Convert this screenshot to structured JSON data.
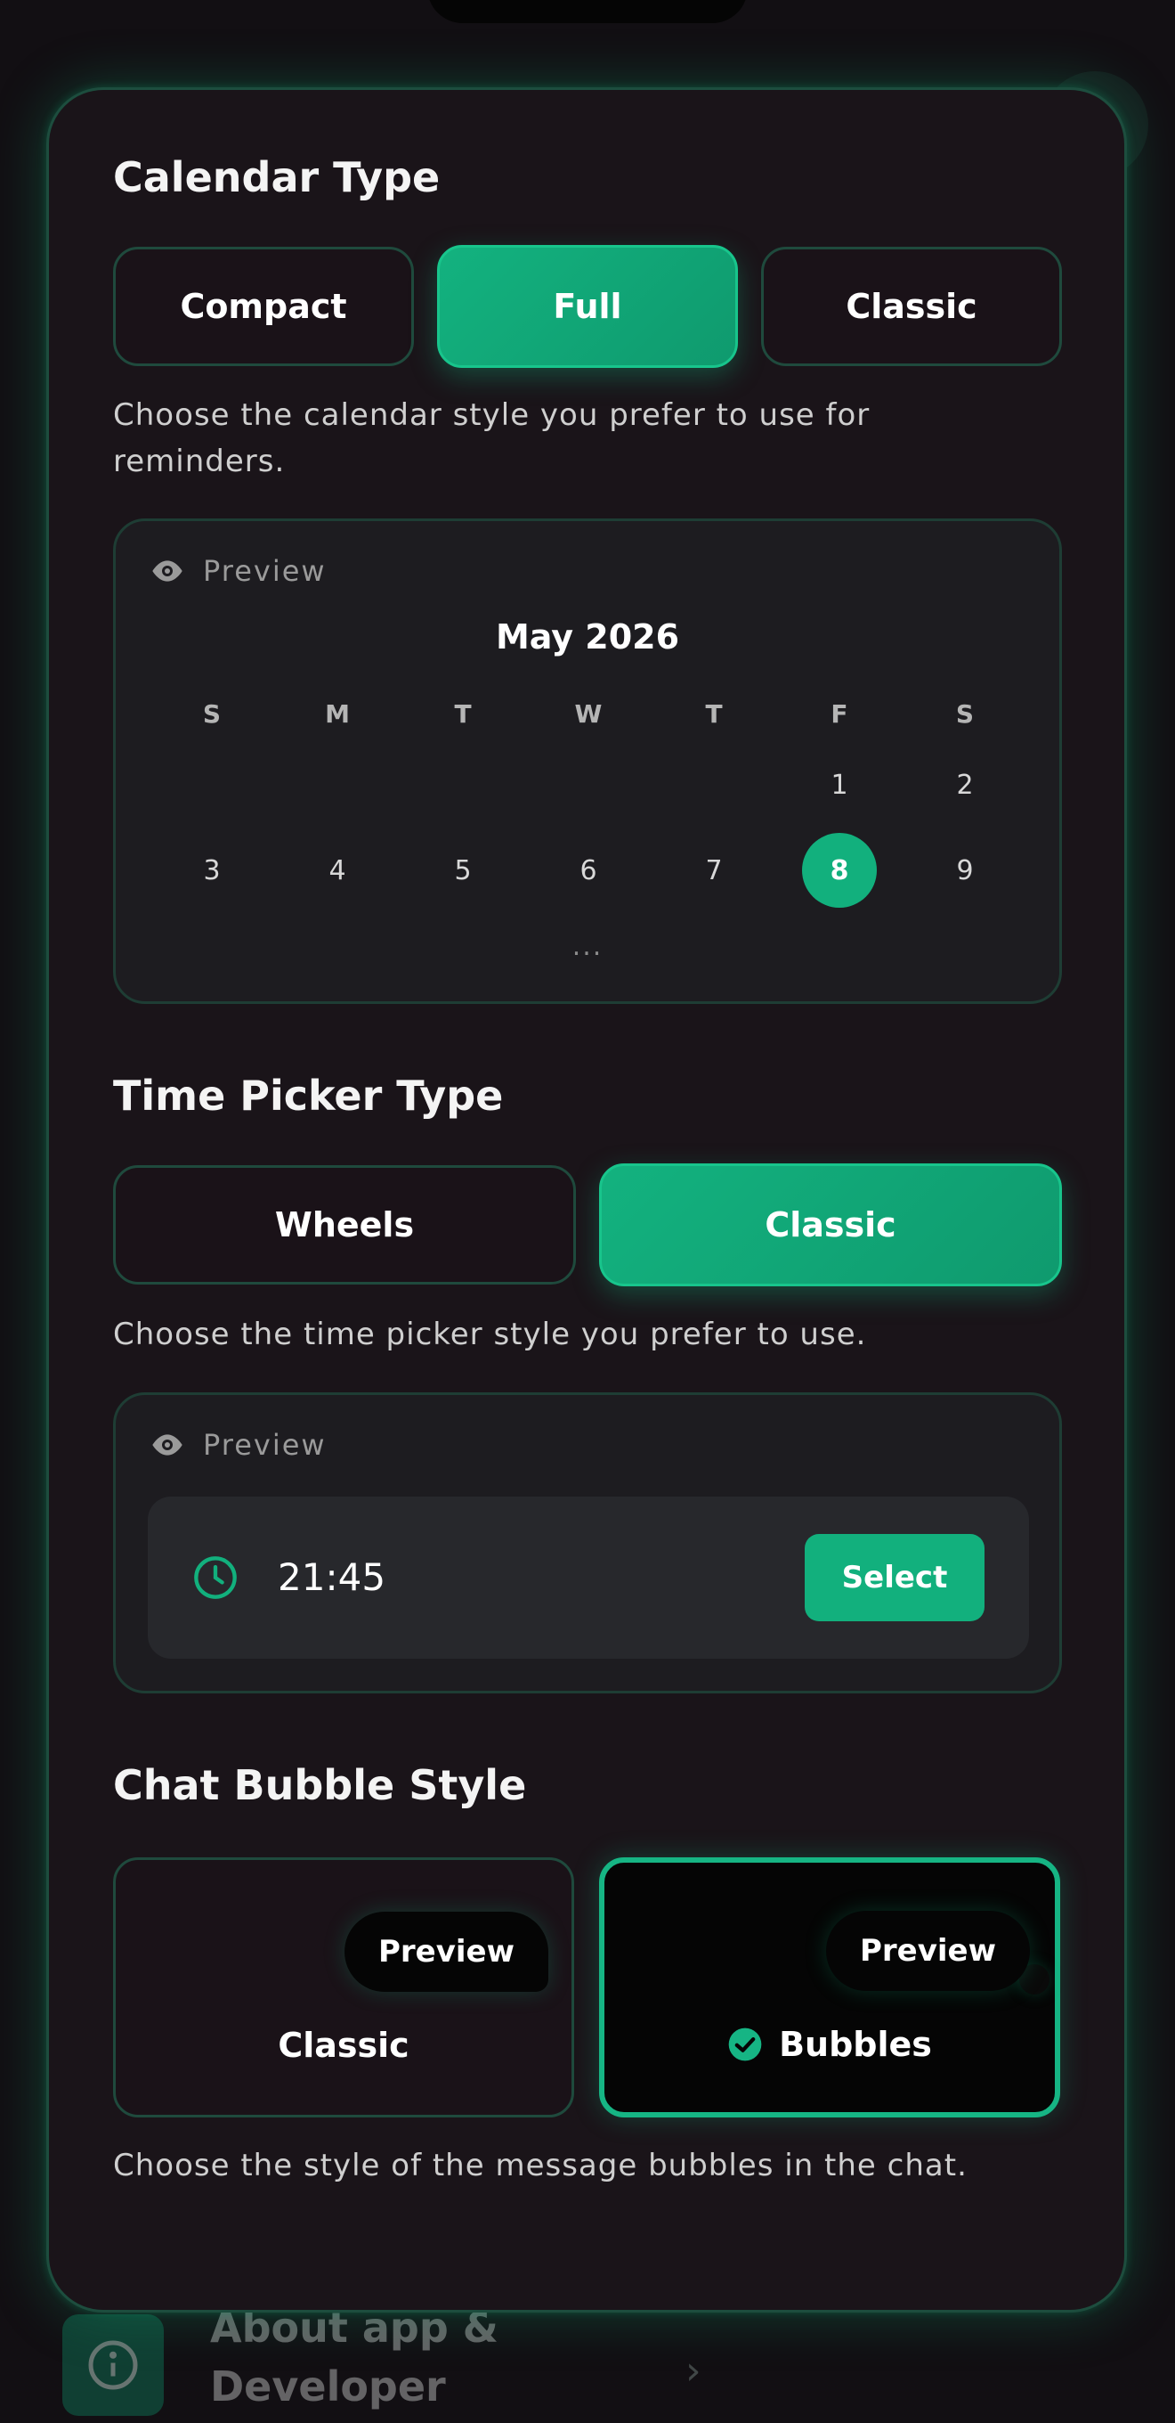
{
  "calendar": {
    "title": "Calendar Type",
    "options": [
      "Compact",
      "Full",
      "Classic"
    ],
    "selected": "Full",
    "description": "Choose the calendar style you prefer to use for reminders.",
    "preview_label": "Preview",
    "month": "May 2026",
    "weekdays": [
      "S",
      "M",
      "T",
      "W",
      "T",
      "F",
      "S"
    ],
    "week1": [
      "",
      "",
      "",
      "",
      "",
      "1",
      "2"
    ],
    "week2": [
      "3",
      "4",
      "5",
      "6",
      "7",
      "8",
      "9"
    ],
    "selected_day": "8",
    "ellipsis": "..."
  },
  "time_picker": {
    "title": "Time Picker Type",
    "options": [
      "Wheels",
      "Classic"
    ],
    "selected": "Classic",
    "description": "Choose the time picker style you prefer to use.",
    "preview_label": "Preview",
    "time": "21:45",
    "select_label": "Select"
  },
  "chat_bubble": {
    "title": "Chat Bubble Style",
    "options": [
      {
        "label": "Classic",
        "bubble": "Preview"
      },
      {
        "label": "Bubbles",
        "bubble": "Preview"
      }
    ],
    "selected": "Bubbles",
    "description": "Choose the style of the message bubbles in the chat."
  },
  "background": {
    "about_label": "About app & Developer"
  },
  "colors": {
    "accent": "#12b07d",
    "card_border": "#1d4d3e",
    "background": "#120f13"
  },
  "icons": {
    "preview": "eye-icon",
    "time": "clock-icon",
    "selected": "check-circle-icon",
    "about": "info-icon",
    "chevron": "chevron-right-icon"
  }
}
